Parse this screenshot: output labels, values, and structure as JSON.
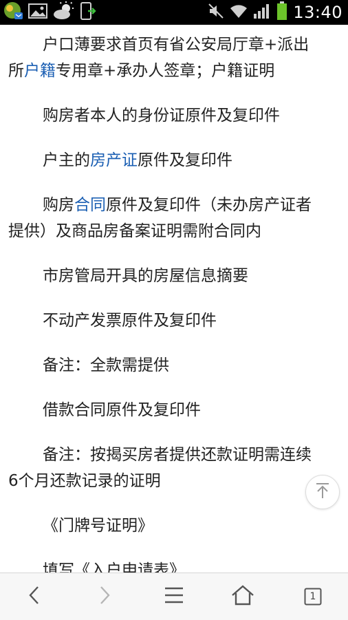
{
  "status_bar": {
    "time": "13:40",
    "icons": [
      "app-icon",
      "image-icon",
      "weather-icon",
      "phone-transfer-icon",
      "mute-icon",
      "wifi-icon",
      "signal-icon",
      "battery-icon"
    ]
  },
  "article": {
    "paragraphs": [
      {
        "lines": [
          [
            {
              "t": "户口薄要求首页有省公安局厅章+派出"
            }
          ],
          [
            {
              "t": "所"
            },
            {
              "t": "户籍",
              "link": true
            },
            {
              "t": "专用章+承办人签章；户籍证明"
            }
          ]
        ]
      },
      {
        "lines": [
          [
            {
              "t": "购房者本人的身份证原件及复印件"
            }
          ]
        ]
      },
      {
        "lines": [
          [
            {
              "t": "户主的"
            },
            {
              "t": "房产证",
              "link": true
            },
            {
              "t": "原件及复印件"
            }
          ]
        ]
      },
      {
        "lines": [
          [
            {
              "t": "购房"
            },
            {
              "t": "合同",
              "link": true
            },
            {
              "t": "原件及复印件（未办房产证者"
            }
          ],
          [
            {
              "t": "提供）及商品房备案证明需附合同内"
            }
          ]
        ]
      },
      {
        "lines": [
          [
            {
              "t": "市房管局开具的房屋信息摘要"
            }
          ]
        ]
      },
      {
        "lines": [
          [
            {
              "t": "不动产发票原件及复印件"
            }
          ]
        ]
      },
      {
        "lines": [
          [
            {
              "t": "备注：全款需提供"
            }
          ]
        ]
      },
      {
        "lines": [
          [
            {
              "t": "借款合同原件及复印件"
            }
          ]
        ]
      },
      {
        "lines": [
          [
            {
              "t": "备注：按揭买房者提供还款证明需连续"
            }
          ],
          [
            {
              "t": "6个月还款记录的证明"
            }
          ]
        ]
      },
      {
        "lines": [
          [
            {
              "t": "《门牌号证明》"
            }
          ]
        ]
      },
      {
        "lines": [
          [
            {
              "t": "填写《入户申请表》"
            }
          ]
        ]
      }
    ],
    "link_color": "#1b5fb3",
    "text_color": "#222222"
  },
  "bottom_nav": {
    "tab_count": "1",
    "icons": [
      "back-arrow-icon",
      "forward-arrow-icon",
      "menu-icon",
      "home-icon",
      "tabs-icon"
    ]
  },
  "floating": {
    "icon": "back-to-top-icon"
  }
}
